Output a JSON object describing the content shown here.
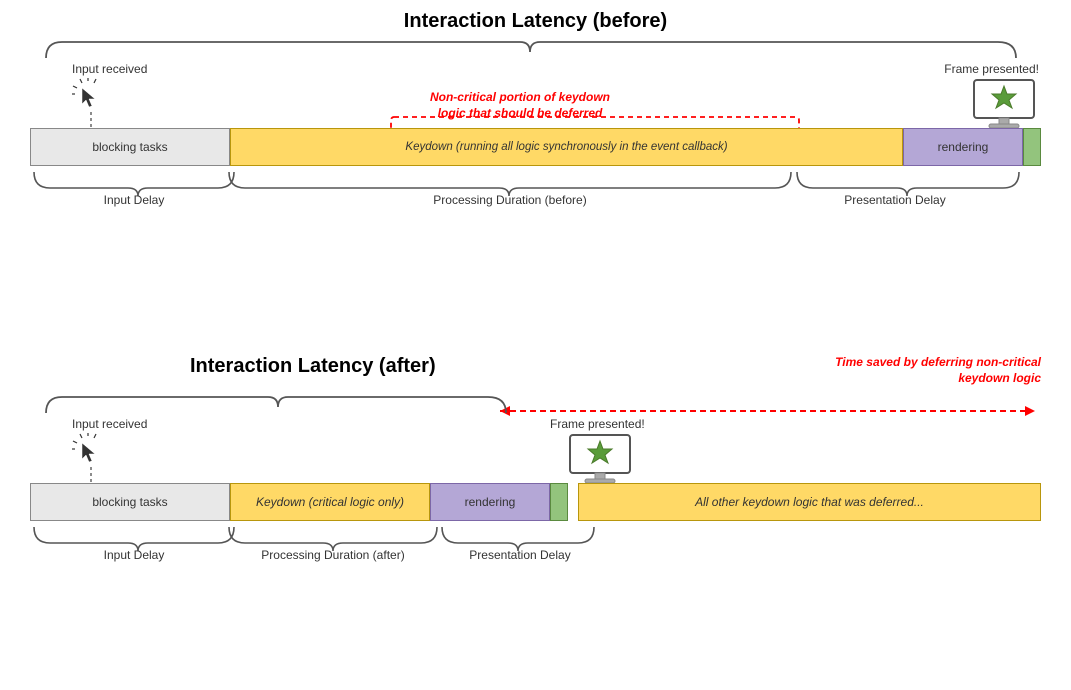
{
  "top": {
    "title": "Interaction Latency (before)",
    "input_received": "Input received",
    "frame_presented": "Frame presented!",
    "noncritical_label": "Non-critical portion of keydown\nlogic that should be deferred",
    "keydown_text": "Keydown (running all logic synchronously in the event callback)",
    "blocking_text": "blocking tasks",
    "rendering_text": "rendering",
    "label_input_delay": "Input Delay",
    "label_processing": "Processing Duration (before)",
    "label_presentation": "Presentation Delay"
  },
  "bottom": {
    "title": "Interaction Latency (after)",
    "input_received": "Input received",
    "frame_presented": "Frame presented!",
    "time_saved_label": "Time saved by deferring\nnon-critical keydown logic",
    "keydown_text": "Keydown (critical logic only)",
    "blocking_text": "blocking tasks",
    "rendering_text": "rendering",
    "deferred_text": "All other keydown logic that was deferred...",
    "label_input_delay": "Input Delay",
    "label_processing": "Processing Duration (after)",
    "label_presentation": "Presentation Delay"
  }
}
